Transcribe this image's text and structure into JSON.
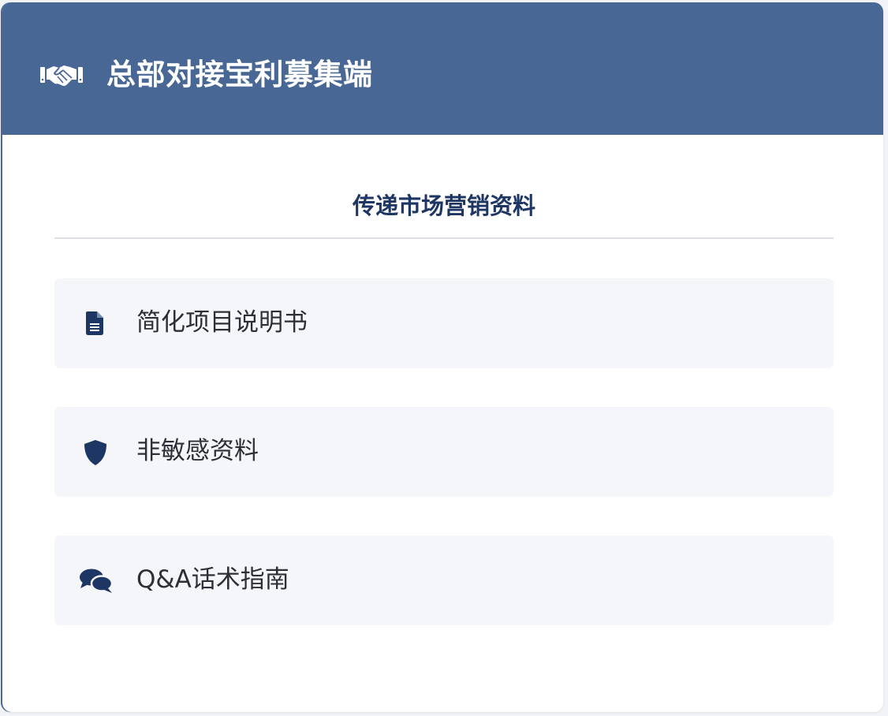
{
  "header": {
    "icon": "handshake-icon",
    "title": "总部对接宝利募集端"
  },
  "section": {
    "title": "传递市场营销资料"
  },
  "menu": {
    "items": [
      {
        "icon": "document-icon",
        "label": "简化项目说明书"
      },
      {
        "icon": "shield-icon",
        "label": "非敏感资料"
      },
      {
        "icon": "comments-icon",
        "label": "Q&A话术指南"
      }
    ]
  },
  "colors": {
    "header_bg": "#486794",
    "header_text": "#ffffff",
    "accent_navy": "#1e3663",
    "item_bg": "#f5f6fa",
    "divider": "#dcdee3"
  }
}
